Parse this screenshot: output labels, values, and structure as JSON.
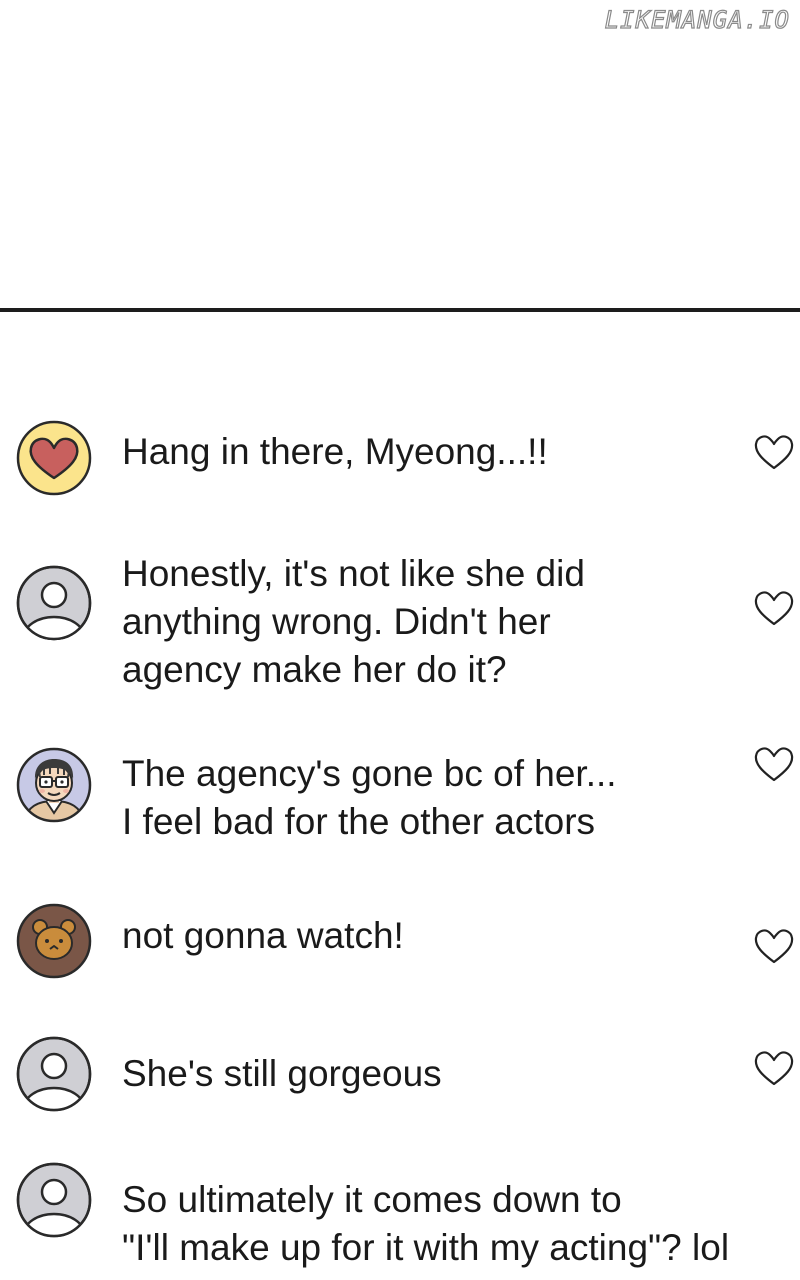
{
  "watermark": "LIKEMANGA.IO",
  "comments": [
    {
      "avatar": "heart-avatar-icon",
      "lines": [
        "Hang in there, Myeong...!!"
      ]
    },
    {
      "avatar": "default-user-avatar-icon",
      "lines": [
        "Honestly, it's not like she did",
        "anything wrong. Didn't her",
        "agency make her do it?"
      ]
    },
    {
      "avatar": "glasses-man-avatar-icon",
      "lines": [
        "The agency's gone bc of her...",
        "I feel bad for the other actors"
      ]
    },
    {
      "avatar": "bear-avatar-icon",
      "lines": [
        "not gonna watch!"
      ]
    },
    {
      "avatar": "default-user-avatar-icon",
      "lines": [
        "She's still gorgeous"
      ]
    },
    {
      "avatar": "default-user-avatar-icon",
      "lines": [
        "So ultimately it comes down to",
        "\"I'll make up for it with my acting\"? lol"
      ]
    }
  ]
}
